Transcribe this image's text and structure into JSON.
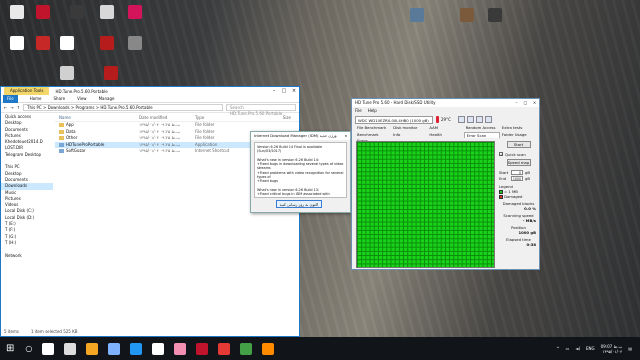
{
  "desktop": {
    "icons": [
      {
        "label": "",
        "color": "#e8e8e8"
      },
      {
        "label": "",
        "color": "#c0132c"
      },
      {
        "label": "",
        "color": "#3a3a3a"
      },
      {
        "label": "",
        "color": "#d8d8d8"
      },
      {
        "label": "",
        "color": "#d4145a"
      },
      {
        "label": "",
        "color": "#ffffff"
      },
      {
        "label": "",
        "color": "#c62828"
      },
      {
        "label": "",
        "color": "#ffffff"
      },
      {
        "label": "",
        "color": "#b71c1c"
      },
      {
        "label": "",
        "color": "#888888"
      },
      {
        "label": "",
        "color": "#d0d0d0"
      },
      {
        "label": "",
        "color": "#b71c1c"
      },
      {
        "label": "",
        "color": "#5a7a9a"
      },
      {
        "label": "",
        "color": "#7a5a3a"
      },
      {
        "label": "",
        "color": "#3a3a3a"
      }
    ]
  },
  "explorer": {
    "app_tools": "Application Tools",
    "title": "HD.Tune.Pro.5.60.Portable",
    "tabs": [
      "File",
      "Home",
      "Share",
      "View",
      "Manage"
    ],
    "path": "This PC > Downloads > Programs > HD.Tune.Pro.5.60.Portable",
    "search_placeholder": "Search HD.Tune.Pro.5.60.Portable",
    "nav": [
      "Quick access",
      "Desktop",
      "Documents",
      "Pictures",
      "Khedoteuet2014.D",
      "LOST.DIR",
      "Telegram Desktop",
      "",
      "This PC",
      "Desktop",
      "Documents",
      "Downloads",
      "Music",
      "Pictures",
      "Videos",
      "Local Disk (C:)",
      "Local Disk (D:)",
      "T (E:)",
      "T (F:)",
      "T (G:)",
      "T (H:)",
      "",
      "Network"
    ],
    "columns": [
      "Name",
      "Date modified",
      "Type",
      "Size"
    ],
    "files": [
      {
        "name": "App",
        "date": "۱۳۹۵/۰۱/۰۴ ۰۹:۲۵ ب.ظ",
        "type": "File folder",
        "size": ""
      },
      {
        "name": "Data",
        "date": "۱۳۹۵/۰۱/۰۴ ۰۹:۲۵ ب.ظ",
        "type": "File folder",
        "size": ""
      },
      {
        "name": "Other",
        "date": "۱۳۹۵/۰۱/۰۴ ۰۹:۲۵ ب.ظ",
        "type": "File folder",
        "size": ""
      },
      {
        "name": "HDTuneProPortable",
        "date": "۱۳۹۵/۰۱/۰۴ ۰۹:۲۵ ب.ظ",
        "type": "Application",
        "size": "525 KB"
      },
      {
        "name": "SoftGozar",
        "date": "۱۳۹۵/۰۱/۰۴ ۰۹:۲۵ ب.ظ",
        "type": "Internet Shortcut",
        "size": "1 KB"
      }
    ],
    "status_items": "5 items",
    "status_selected": "1 item selected  525 KB"
  },
  "dialog": {
    "title": "Internet Download Manager (IDM) ورژن جدید",
    "lines": [
      "Version 6.26 Build 14 Final is available (Sun/03/2017)",
      "",
      "What's new in version 6.26 Build 14:",
      "+Fixed bugs in downloading several types of video streams",
      "+Fixed problems with video recognition for several types of",
      "+Fixed bugs",
      "",
      "What's new in version 6.26 Build 13:",
      "+Fixed critical bugs in IDM associated with",
      "+and in Internet Integration module"
    ],
    "button": "اکنون به روز رسانی کنید"
  },
  "hdtune": {
    "title": "HD Tune Pro 5.60 - Hard Disk/SSD Utility",
    "menu": [
      "File",
      "Help"
    ],
    "drive": "WDC WD10EZRX-00L4HB0 (1000 gB)",
    "temp": "29°C",
    "tabs": [
      "File Benchmark",
      "Disk monitor",
      "AAM",
      "Random Access",
      "Extra tests",
      "Benchmark",
      "Info",
      "Health",
      "Error Scan",
      "Folder Usage",
      "Erase"
    ],
    "start_button": "Start",
    "quick_scan_label": "Quick scan",
    "quick_scan_checked": true,
    "speed_map_button": "Speed map",
    "start_label": "Start",
    "start_value": "0",
    "end_label": "End",
    "end_value": "1000",
    "unit": "gB",
    "legend_title": "Legend",
    "legend_ok": "= 1 MB",
    "legend_ok_color": "#19d219",
    "legend_damaged": "Damaged",
    "legend_damaged_color": "#d32f2f",
    "damaged_blocks_label": "Damaged blocks",
    "damaged_blocks_value": "0.0 %",
    "scan_speed_label": "Scanning speed",
    "scan_speed_value": "- MB/s",
    "position_label": "Position",
    "position_value": "1000 gB",
    "elapsed_label": "Elapsed time",
    "elapsed_value": "0:38"
  },
  "taskbar": {
    "icons": [
      "#ffffff",
      "#dddddd",
      "#f5a623",
      "#7fb3ff",
      "#2196f3",
      "#ffffff",
      "#f48fb1",
      "#c0132c",
      "#e53935",
      "#43a047",
      "#ff8a00"
    ],
    "language": "ENG",
    "time": "09:07 ب.ظ",
    "date": "۱۳۹۵/۰۱/۰۴"
  }
}
